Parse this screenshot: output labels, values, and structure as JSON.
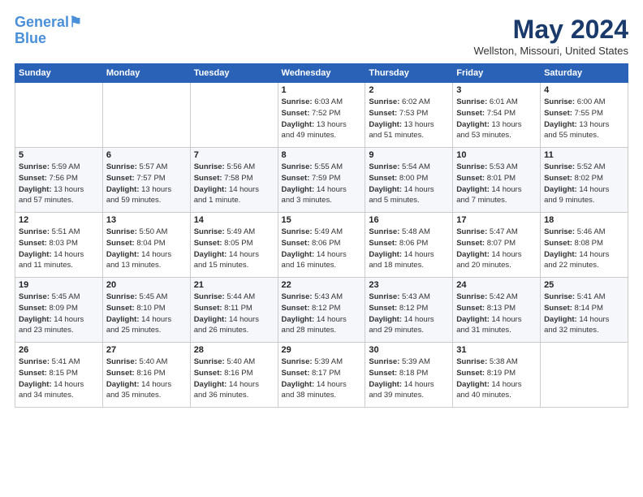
{
  "header": {
    "logo_line1": "General",
    "logo_line2": "Blue",
    "title": "May 2024",
    "subtitle": "Wellston, Missouri, United States"
  },
  "days_of_week": [
    "Sunday",
    "Monday",
    "Tuesday",
    "Wednesday",
    "Thursday",
    "Friday",
    "Saturday"
  ],
  "weeks": [
    [
      {
        "day": "",
        "info": ""
      },
      {
        "day": "",
        "info": ""
      },
      {
        "day": "",
        "info": ""
      },
      {
        "day": "1",
        "info": "Sunrise: 6:03 AM\nSunset: 7:52 PM\nDaylight: 13 hours\nand 49 minutes."
      },
      {
        "day": "2",
        "info": "Sunrise: 6:02 AM\nSunset: 7:53 PM\nDaylight: 13 hours\nand 51 minutes."
      },
      {
        "day": "3",
        "info": "Sunrise: 6:01 AM\nSunset: 7:54 PM\nDaylight: 13 hours\nand 53 minutes."
      },
      {
        "day": "4",
        "info": "Sunrise: 6:00 AM\nSunset: 7:55 PM\nDaylight: 13 hours\nand 55 minutes."
      }
    ],
    [
      {
        "day": "5",
        "info": "Sunrise: 5:59 AM\nSunset: 7:56 PM\nDaylight: 13 hours\nand 57 minutes."
      },
      {
        "day": "6",
        "info": "Sunrise: 5:57 AM\nSunset: 7:57 PM\nDaylight: 13 hours\nand 59 minutes."
      },
      {
        "day": "7",
        "info": "Sunrise: 5:56 AM\nSunset: 7:58 PM\nDaylight: 14 hours\nand 1 minute."
      },
      {
        "day": "8",
        "info": "Sunrise: 5:55 AM\nSunset: 7:59 PM\nDaylight: 14 hours\nand 3 minutes."
      },
      {
        "day": "9",
        "info": "Sunrise: 5:54 AM\nSunset: 8:00 PM\nDaylight: 14 hours\nand 5 minutes."
      },
      {
        "day": "10",
        "info": "Sunrise: 5:53 AM\nSunset: 8:01 PM\nDaylight: 14 hours\nand 7 minutes."
      },
      {
        "day": "11",
        "info": "Sunrise: 5:52 AM\nSunset: 8:02 PM\nDaylight: 14 hours\nand 9 minutes."
      }
    ],
    [
      {
        "day": "12",
        "info": "Sunrise: 5:51 AM\nSunset: 8:03 PM\nDaylight: 14 hours\nand 11 minutes."
      },
      {
        "day": "13",
        "info": "Sunrise: 5:50 AM\nSunset: 8:04 PM\nDaylight: 14 hours\nand 13 minutes."
      },
      {
        "day": "14",
        "info": "Sunrise: 5:49 AM\nSunset: 8:05 PM\nDaylight: 14 hours\nand 15 minutes."
      },
      {
        "day": "15",
        "info": "Sunrise: 5:49 AM\nSunset: 8:06 PM\nDaylight: 14 hours\nand 16 minutes."
      },
      {
        "day": "16",
        "info": "Sunrise: 5:48 AM\nSunset: 8:06 PM\nDaylight: 14 hours\nand 18 minutes."
      },
      {
        "day": "17",
        "info": "Sunrise: 5:47 AM\nSunset: 8:07 PM\nDaylight: 14 hours\nand 20 minutes."
      },
      {
        "day": "18",
        "info": "Sunrise: 5:46 AM\nSunset: 8:08 PM\nDaylight: 14 hours\nand 22 minutes."
      }
    ],
    [
      {
        "day": "19",
        "info": "Sunrise: 5:45 AM\nSunset: 8:09 PM\nDaylight: 14 hours\nand 23 minutes."
      },
      {
        "day": "20",
        "info": "Sunrise: 5:45 AM\nSunset: 8:10 PM\nDaylight: 14 hours\nand 25 minutes."
      },
      {
        "day": "21",
        "info": "Sunrise: 5:44 AM\nSunset: 8:11 PM\nDaylight: 14 hours\nand 26 minutes."
      },
      {
        "day": "22",
        "info": "Sunrise: 5:43 AM\nSunset: 8:12 PM\nDaylight: 14 hours\nand 28 minutes."
      },
      {
        "day": "23",
        "info": "Sunrise: 5:43 AM\nSunset: 8:12 PM\nDaylight: 14 hours\nand 29 minutes."
      },
      {
        "day": "24",
        "info": "Sunrise: 5:42 AM\nSunset: 8:13 PM\nDaylight: 14 hours\nand 31 minutes."
      },
      {
        "day": "25",
        "info": "Sunrise: 5:41 AM\nSunset: 8:14 PM\nDaylight: 14 hours\nand 32 minutes."
      }
    ],
    [
      {
        "day": "26",
        "info": "Sunrise: 5:41 AM\nSunset: 8:15 PM\nDaylight: 14 hours\nand 34 minutes."
      },
      {
        "day": "27",
        "info": "Sunrise: 5:40 AM\nSunset: 8:16 PM\nDaylight: 14 hours\nand 35 minutes."
      },
      {
        "day": "28",
        "info": "Sunrise: 5:40 AM\nSunset: 8:16 PM\nDaylight: 14 hours\nand 36 minutes."
      },
      {
        "day": "29",
        "info": "Sunrise: 5:39 AM\nSunset: 8:17 PM\nDaylight: 14 hours\nand 38 minutes."
      },
      {
        "day": "30",
        "info": "Sunrise: 5:39 AM\nSunset: 8:18 PM\nDaylight: 14 hours\nand 39 minutes."
      },
      {
        "day": "31",
        "info": "Sunrise: 5:38 AM\nSunset: 8:19 PM\nDaylight: 14 hours\nand 40 minutes."
      },
      {
        "day": "",
        "info": ""
      }
    ]
  ]
}
